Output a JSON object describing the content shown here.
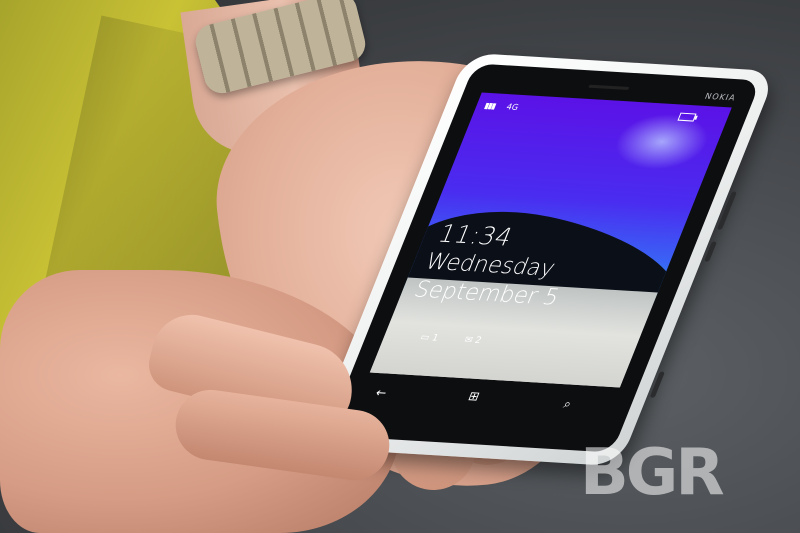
{
  "phone": {
    "brand": "NOKIA",
    "status": {
      "signal": "▮▮▮",
      "network": "4G"
    },
    "lock_screen": {
      "time": "11:34",
      "day": "Wednesday",
      "date": "September 5",
      "notifications": [
        {
          "icon": "message-icon",
          "count": "1"
        },
        {
          "icon": "mail-icon",
          "count": "2"
        }
      ]
    },
    "keys": {
      "back": "←",
      "start": "⊞",
      "search": "⌕"
    }
  },
  "watermark": {
    "text": "BGR",
    "color": "#ffffff"
  },
  "colors": {
    "screen_top": "#5b12e6",
    "shirt": "#c9c235",
    "phone_body": "#f2f3f3"
  }
}
